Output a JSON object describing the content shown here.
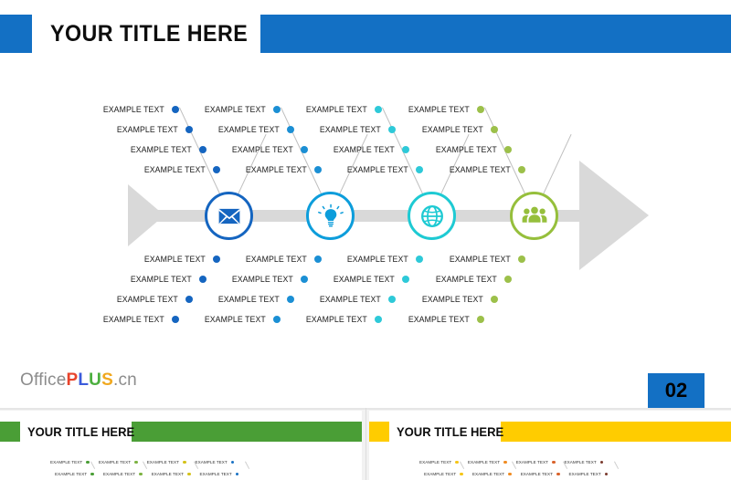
{
  "slide": {
    "title": "YOUR TITLE HERE",
    "page_number": "02",
    "accent_color": "#1370c4",
    "spine_color": "#d9d9d9",
    "label_text": "EXAMPLE TEXT"
  },
  "logo": {
    "office": "Office",
    "p": "P",
    "l": "L",
    "u": "U",
    "s": "S",
    "cn": ".cn"
  },
  "branches": [
    {
      "icon": "envelope-icon",
      "color": "#1565c0",
      "top_labels": [
        "EXAMPLE TEXT",
        "EXAMPLE TEXT",
        "EXAMPLE TEXT",
        "EXAMPLE TEXT"
      ],
      "bottom_labels": [
        "EXAMPLE TEXT",
        "EXAMPLE TEXT",
        "EXAMPLE TEXT",
        "EXAMPLE TEXT"
      ]
    },
    {
      "icon": "lightbulb-icon",
      "color": "#0d9ddb",
      "top_labels": [
        "EXAMPLE TEXT",
        "EXAMPLE TEXT",
        "EXAMPLE TEXT",
        "EXAMPLE TEXT"
      ],
      "bottom_labels": [
        "EXAMPLE TEXT",
        "EXAMPLE TEXT",
        "EXAMPLE TEXT",
        "EXAMPLE TEXT"
      ]
    },
    {
      "icon": "globe-icon",
      "color": "#1ecad3",
      "top_labels": [
        "EXAMPLE TEXT",
        "EXAMPLE TEXT",
        "EXAMPLE TEXT",
        "EXAMPLE TEXT"
      ],
      "bottom_labels": [
        "EXAMPLE TEXT",
        "EXAMPLE TEXT",
        "EXAMPLE TEXT",
        "EXAMPLE TEXT"
      ]
    },
    {
      "icon": "people-icon",
      "color": "#96bf3c",
      "top_labels": [
        "EXAMPLE TEXT",
        "EXAMPLE TEXT",
        "EXAMPLE TEXT",
        "EXAMPLE TEXT"
      ],
      "bottom_labels": [
        "EXAMPLE TEXT",
        "EXAMPLE TEXT",
        "EXAMPLE TEXT",
        "EXAMPLE TEXT"
      ]
    }
  ],
  "thumbnails": [
    {
      "title": "YOUR TITLE HERE",
      "bar_color": "#4a9e36",
      "dot_colors": [
        "#4a9e36",
        "#7cb342",
        "#d4c21a",
        "#1a72c4"
      ],
      "label": "EXAMPLE TEXT"
    },
    {
      "title": "YOUR TITLE HERE",
      "bar_color": "#ffcc00",
      "dot_colors": [
        "#f5c518",
        "#f08c22",
        "#d9622b",
        "#7a3b2e"
      ],
      "label": "EXAMPLE TEXT"
    }
  ]
}
